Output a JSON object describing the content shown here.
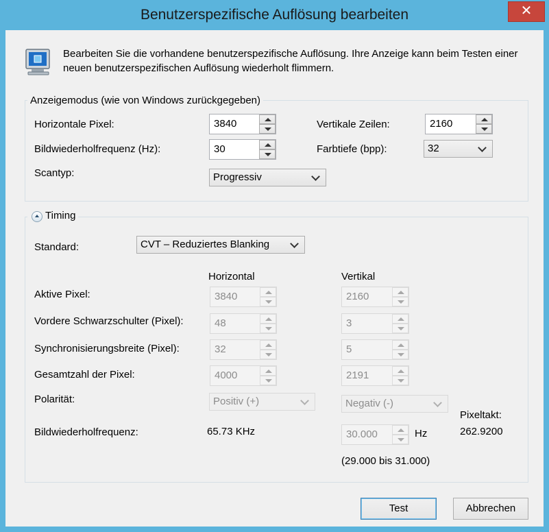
{
  "window": {
    "title": "Benutzerspezifische Auflösung bearbeiten",
    "close_glyph": "✕"
  },
  "description": "Bearbeiten Sie die vorhandene benutzerspezifische Auflösung. Ihre Anzeige kann beim Testen einer neuen benutzerspezifischen Auflösung wiederholt flimmern.",
  "display_mode": {
    "group_title": "Anzeigemodus (wie von Windows zurückgegeben)",
    "horizontal_pixels": {
      "label": "Horizontale Pixel:",
      "value": "3840"
    },
    "vertical_lines": {
      "label": "Vertikale Zeilen:",
      "value": "2160"
    },
    "refresh_rate": {
      "label": "Bildwiederholfrequenz (Hz):",
      "value": "30"
    },
    "color_depth": {
      "label": "Farbtiefe (bpp):",
      "value": "32"
    },
    "scan_type": {
      "label": "Scantyp:",
      "value": "Progressiv"
    }
  },
  "timing": {
    "group_title": "Timing",
    "standard": {
      "label": "Standard:",
      "value": "CVT – Reduziertes Blanking"
    },
    "col_horizontal": "Horizontal",
    "col_vertical": "Vertikal",
    "rows": [
      {
        "label": "Aktive Pixel:",
        "h": "3840",
        "v": "2160"
      },
      {
        "label": "Vordere Schwarzschulter (Pixel):",
        "h": "48",
        "v": "3"
      },
      {
        "label": "Synchronisierungsbreite (Pixel):",
        "h": "32",
        "v": "5"
      },
      {
        "label": "Gesamtzahl der Pixel:",
        "h": "4000",
        "v": "2191"
      }
    ],
    "polarity": {
      "label": "Polarität:",
      "h": "Positiv (+)",
      "v": "Negativ (-)"
    },
    "refresh": {
      "label": "Bildwiederholfrequenz:",
      "h_value": "65.73 KHz",
      "v_value": "30.000",
      "unit": "Hz",
      "range": "(29.000 bis 31.000)"
    },
    "pixel_clock": {
      "label": "Pixeltakt:",
      "value": "262.9200"
    }
  },
  "buttons": {
    "test": "Test",
    "cancel": "Abbrechen"
  },
  "colors": {
    "window_frame": "#5bb4dc",
    "close_button": "#c7463c",
    "client_bg": "#f0f0f0"
  }
}
